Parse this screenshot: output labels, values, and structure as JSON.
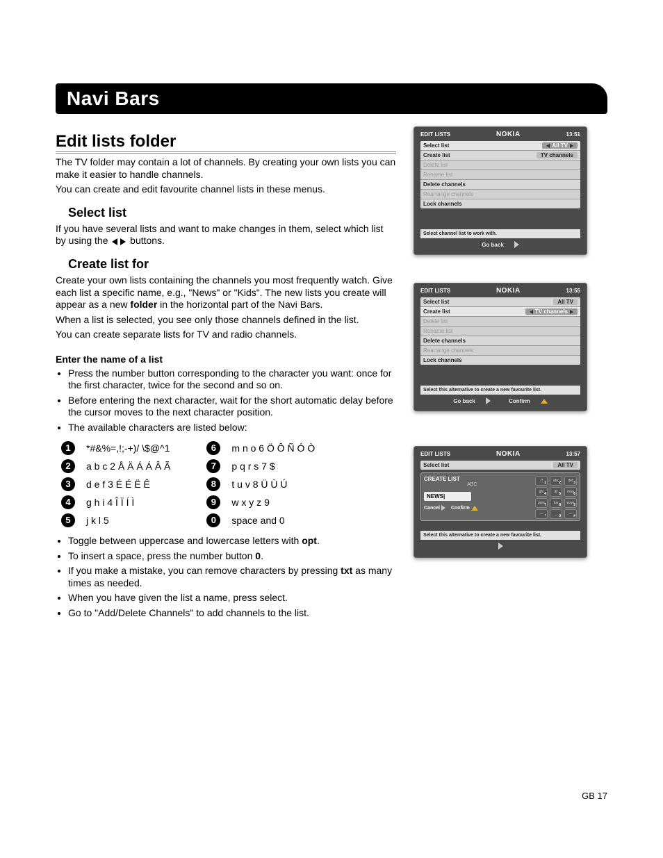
{
  "title_bar": "Navi Bars",
  "section_heading": "Edit lists folder",
  "intro_p1": "The TV folder may contain a lot of channels. By creating your own lists you can make it easier to handle channels.",
  "intro_p2": "You can create and edit favourite channel lists in these menus.",
  "h_select_list": "Select list",
  "p_select_list_a": "If you have several lists and want to make changes in them, select which list by using the ",
  "p_select_list_b": " buttons.",
  "h_create_list": "Create list for",
  "p_create_1a": "Create your own lists containing the channels you most frequently watch. Give each list a specific name, e.g., \"News\" or \"Kids\". The new lists you create will appear as a new ",
  "p_create_1_bold": "folder",
  "p_create_1b": " in the horizontal part of the Navi Bars.",
  "p_create_2": "When a list is selected, you see only those channels defined in the list.",
  "p_create_3": "You can create separate lists for TV and radio channels.",
  "h_enter_name": "Enter the name of a list",
  "bul_enter_1": "Press the number button corresponding to the character you want: once for the first character, twice for the second and so on.",
  "bul_enter_2": "Before entering the next character, wait for the short automatic delay before the cursor moves to the next character position.",
  "bul_enter_3": "The available characters are listed below:",
  "keymap": [
    {
      "k": "1",
      "v": "*#&%=,!;-+)/ \\$@^1"
    },
    {
      "k": "2",
      "v": "a b c 2 Å Ä Á Á Â Ã"
    },
    {
      "k": "3",
      "v": "d e f 3 É É Ë Ê"
    },
    {
      "k": "4",
      "v": "g h i 4 Î Ï Í Ì"
    },
    {
      "k": "5",
      "v": "j k l 5"
    },
    {
      "k": "6",
      "v": "m n o 6 Ö Ô Ñ Ó Ò"
    },
    {
      "k": "7",
      "v": "p q r s 7 $"
    },
    {
      "k": "8",
      "v": "t u v 8 Ü Ù Ú"
    },
    {
      "k": "9",
      "v": "w x y z 9"
    },
    {
      "k": "0",
      "v": "space and 0"
    }
  ],
  "bul_post_1a": "Toggle between uppercase and lowercase letters with ",
  "bul_post_1_bold": "opt",
  "bul_post_1b": ".",
  "bul_post_2a": "To insert a space, press the number button ",
  "bul_post_2_bold": "0",
  "bul_post_2b": ".",
  "bul_post_3a": "If you make a mistake, you can remove characters by pressing ",
  "bul_post_3_bold": "txt",
  "bul_post_3b": " as many times as needed.",
  "bul_post_4": "When you have given the list a name, press select.",
  "bul_post_5": "Go to \"Add/Delete Channels\" to add channels to the list.",
  "page_number": "GB 17",
  "panel1": {
    "title": "EDIT LISTS",
    "brand": "NOKIA",
    "time": "13:51",
    "rows": [
      {
        "l": "Select list",
        "r": "All TV",
        "sel": true,
        "dim": false,
        "arrows": true
      },
      {
        "l": "Create list",
        "r": "TV channels",
        "sel": false,
        "dim": false,
        "arrows": false
      },
      {
        "l": "Delete list",
        "r": "",
        "sel": false,
        "dim": true,
        "arrows": false
      },
      {
        "l": "Rename list",
        "r": "",
        "sel": false,
        "dim": true,
        "arrows": false
      },
      {
        "l": "Delete channels",
        "r": "",
        "sel": false,
        "dim": false,
        "arrows": false
      },
      {
        "l": "Rearrange channels",
        "r": "",
        "sel": false,
        "dim": true,
        "arrows": false
      },
      {
        "l": "Lock channels",
        "r": "",
        "sel": false,
        "dim": false,
        "arrows": false
      }
    ],
    "hint": "Select channel list to work with.",
    "footer_back": "Go back"
  },
  "panel2": {
    "title": "EDIT LISTS",
    "brand": "NOKIA",
    "time": "13:55",
    "rows": [
      {
        "l": "Select list",
        "r": "All TV",
        "sel": false,
        "dim": false,
        "arrows": false
      },
      {
        "l": "Create list",
        "r": "TV channels",
        "sel": true,
        "dim": false,
        "arrows": true
      },
      {
        "l": "Delete list",
        "r": "",
        "sel": false,
        "dim": true,
        "arrows": false
      },
      {
        "l": "Rename list",
        "r": "",
        "sel": false,
        "dim": true,
        "arrows": false
      },
      {
        "l": "Delete channels",
        "r": "",
        "sel": false,
        "dim": false,
        "arrows": false
      },
      {
        "l": "Rearrange channels",
        "r": "",
        "sel": false,
        "dim": true,
        "arrows": false
      },
      {
        "l": "Lock channels",
        "r": "",
        "sel": false,
        "dim": false,
        "arrows": false
      }
    ],
    "hint": "Select this alternative to create a new favourite list.",
    "footer_back": "Go back",
    "footer_confirm": "Confirm"
  },
  "panel3": {
    "title": "EDIT LISTS",
    "brand": "NOKIA",
    "time": "13:57",
    "rows": [
      {
        "l": "Select list",
        "r": "All TV",
        "sel": false,
        "dim": false,
        "arrows": false
      }
    ],
    "create_label": "CREATE LIST",
    "abc": "ABC",
    "field_value": "NEWS|",
    "cancel": "Cancel",
    "confirm": "Confirm",
    "hint": "Select this alternative to create a new favourite list.",
    "keypad": [
      [
        "./!",
        "abc",
        "def"
      ],
      [
        "ghi",
        "jkl",
        "mno"
      ],
      [
        "pqrs",
        "tuv",
        "wxyz"
      ],
      [
        "—",
        "_",
        "—"
      ]
    ],
    "keypad_nums": [
      [
        "1",
        "2",
        "3"
      ],
      [
        "4",
        "5",
        "6"
      ],
      [
        "7",
        "8",
        "9"
      ],
      [
        "*",
        "0",
        "#"
      ]
    ]
  }
}
